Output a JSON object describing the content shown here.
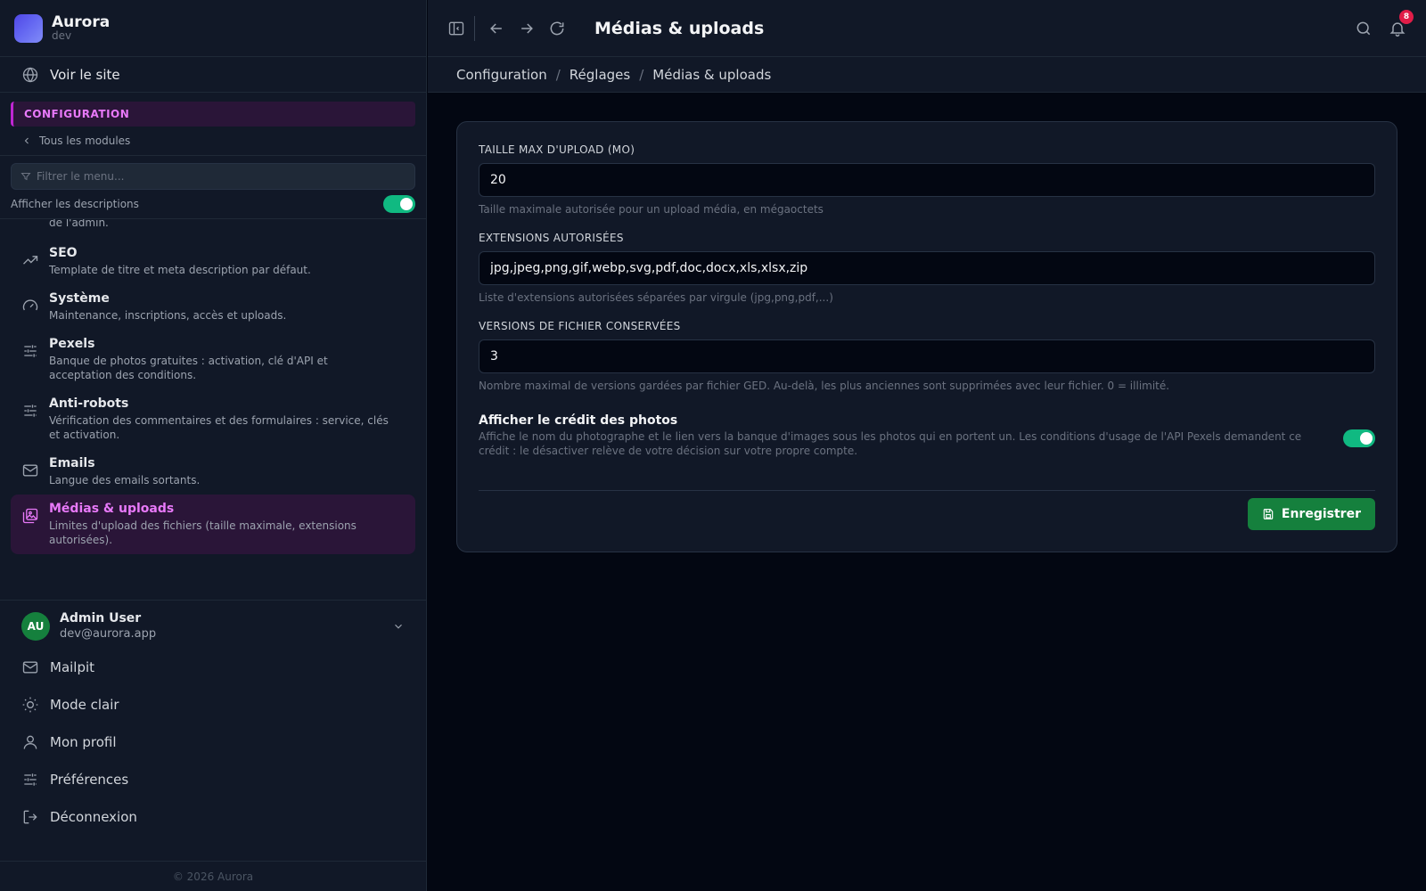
{
  "brand": {
    "name": "Aurora",
    "env": "dev"
  },
  "sidebar": {
    "visit_site": "Voir le site",
    "section": "CONFIGURATION",
    "back": "Tous les modules",
    "filter_placeholder": "Filtrer le menu...",
    "show_descriptions": "Afficher les descriptions",
    "show_descriptions_on": true,
    "clipped_desc": "de l'admin.",
    "modules": [
      {
        "icon": "trending-up-icon",
        "title": "SEO",
        "desc": "Template de titre et meta description par défaut."
      },
      {
        "icon": "gauge-icon",
        "title": "Système",
        "desc": "Maintenance, inscriptions, accès et uploads."
      },
      {
        "icon": "sliders-icon",
        "title": "Pexels",
        "desc": "Banque de photos gratuites : activation, clé d'API et acceptation des conditions."
      },
      {
        "icon": "sliders-icon",
        "title": "Anti-robots",
        "desc": "Vérification des commentaires et des formulaires : service, clés et activation."
      },
      {
        "icon": "mail-icon",
        "title": "Emails",
        "desc": "Langue des emails sortants."
      },
      {
        "icon": "images-icon",
        "title": "Médias & uploads",
        "desc": "Limites d'upload des fichiers (taille maximale, extensions autorisées).",
        "active": true
      }
    ],
    "user": {
      "initials": "AU",
      "name": "Admin User",
      "email": "dev@aurora.app"
    },
    "menu": [
      {
        "icon": "mail-icon",
        "label": "Mailpit"
      },
      {
        "icon": "sun-icon",
        "label": "Mode clair"
      },
      {
        "icon": "user-icon",
        "label": "Mon profil"
      },
      {
        "icon": "sliders-icon",
        "label": "Préférences"
      },
      {
        "icon": "logout-icon",
        "label": "Déconnexion"
      }
    ],
    "footer": "© 2026 Aurora"
  },
  "topbar": {
    "title": "Médias & uploads",
    "notifications": "8"
  },
  "breadcrumb": [
    "Configuration",
    "Réglages",
    "Médias & uploads"
  ],
  "form": {
    "max_upload": {
      "label": "TAILLE MAX D'UPLOAD (MO)",
      "value": "20",
      "help": "Taille maximale autorisée pour un upload média, en mégaoctets"
    },
    "extensions": {
      "label": "EXTENSIONS AUTORISÉES",
      "value": "jpg,jpeg,png,gif,webp,svg,pdf,doc,docx,xls,xlsx,zip",
      "help": "Liste d'extensions autorisées séparées par virgule (jpg,png,pdf,...)"
    },
    "versions": {
      "label": "VERSIONS DE FICHIER CONSERVÉES",
      "value": "3",
      "help": "Nombre maximal de versions gardées par fichier GED. Au-delà, les plus anciennes sont supprimées avec leur fichier. 0 = illimité."
    },
    "photo_credit": {
      "title": "Afficher le crédit des photos",
      "desc": "Affiche le nom du photographe et le lien vers la banque d'images sous les photos qui en portent un. Les conditions d'usage de l'API Pexels demandent ce crédit : le désactiver relève de votre décision sur votre propre compte.",
      "enabled": true
    },
    "save_label": "Enregistrer"
  },
  "colors": {
    "accent": "#e879f9",
    "success": "#15803d",
    "toggle_on": "#10b981"
  }
}
